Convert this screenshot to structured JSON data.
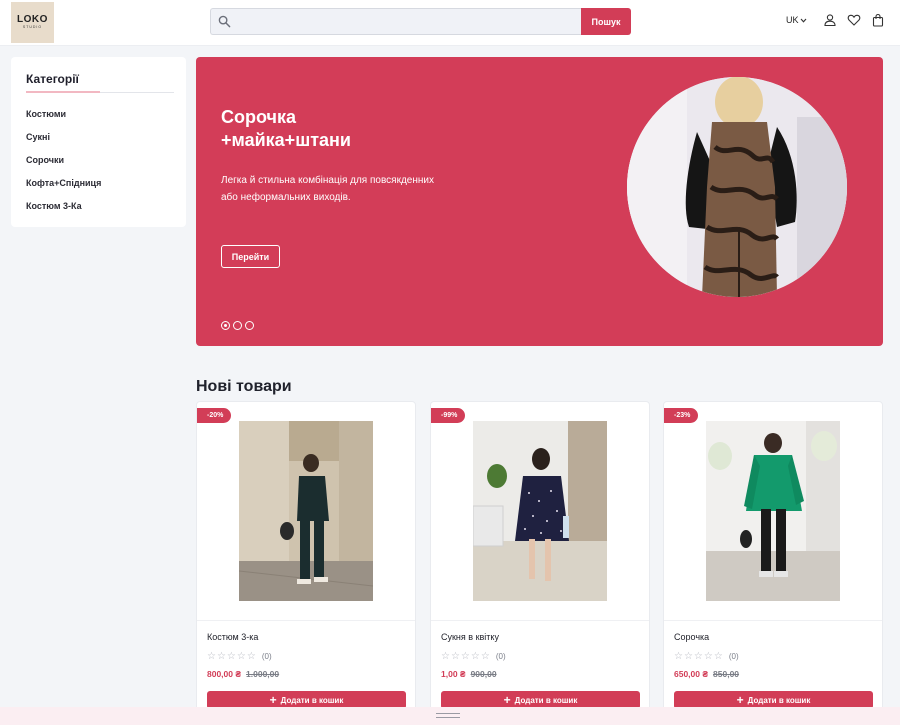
{
  "header": {
    "logo": {
      "title": "LOKO",
      "subtitle": "STUDIO"
    },
    "search": {
      "placeholder": "",
      "button_label": "Пошук"
    },
    "language": "UK"
  },
  "sidebar": {
    "title": "Категорії",
    "items": [
      {
        "label": "Костюми"
      },
      {
        "label": "Сукні"
      },
      {
        "label": "Сорочки"
      },
      {
        "label": "Кофта+Спідниця"
      },
      {
        "label": "Костюм 3-Ка"
      }
    ]
  },
  "hero": {
    "title_line1": "Сорочка",
    "title_line2": "+майка+штани",
    "description": "Легка й стильна комбінація для повсякденних або неформальних виходів.",
    "button_label": "Перейти",
    "slides_total": 3,
    "active_slide": 1
  },
  "new_products": {
    "title": "Нові товари",
    "products": [
      {
        "badge": "-20%",
        "name": "Костюм 3-ка",
        "rating_count": "(0)",
        "price": "800,00 ₴",
        "old_price": "1.000,00",
        "cart_label": "Додати в кошик"
      },
      {
        "badge": "-99%",
        "name": "Сукня в квітку",
        "rating_count": "(0)",
        "price": "1,00 ₴",
        "old_price": "900,00",
        "cart_label": "Додати в кошик"
      },
      {
        "badge": "-23%",
        "name": "Сорочка",
        "rating_count": "(0)",
        "price": "650,00 ₴",
        "old_price": "850,00",
        "cart_label": "Додати в кошик"
      }
    ]
  },
  "colors": {
    "accent": "#d23d57",
    "hero_bg": "#d33d58",
    "page_bg": "#f3f5f8"
  },
  "icons": [
    "search-icon",
    "chevron-down-icon",
    "user-icon",
    "heart-icon",
    "shopping-bag-icon",
    "star-icon",
    "plus-icon"
  ]
}
